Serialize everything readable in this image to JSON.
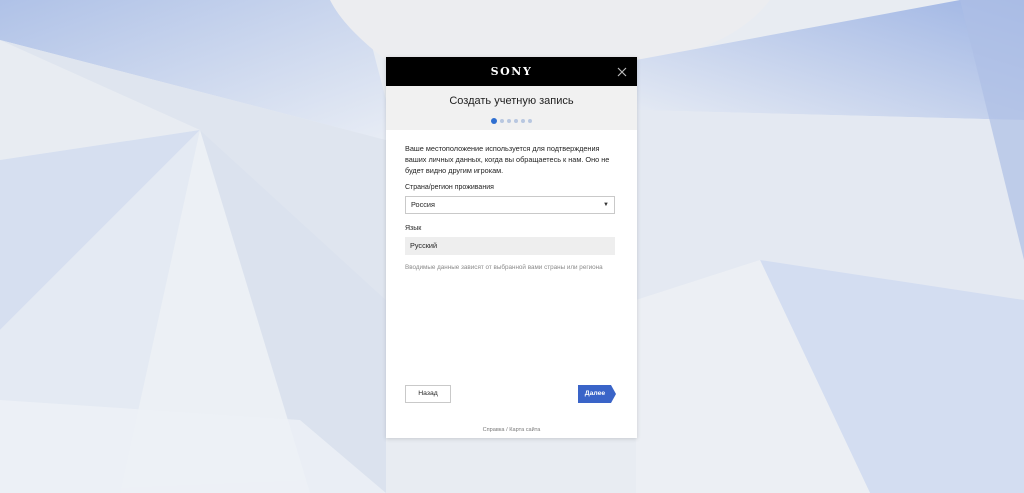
{
  "brand": {
    "logo_text": "SONY"
  },
  "dialog": {
    "title": "Создать учетную запись",
    "steps_total": 6,
    "current_step": 1,
    "description": "Ваше местоположение используется для подтверждения ваших личных данных, когда вы обращаетесь к нам. Оно не будет видно другим игрокам.",
    "country": {
      "label": "Страна/регион проживания",
      "value": "Россия"
    },
    "language": {
      "label": "Язык",
      "value": "Русский"
    },
    "hint": "Вводимые данные зависят от выбранной вами страны или региона",
    "buttons": {
      "back": "Назад",
      "next": "Далее"
    },
    "footer": {
      "help": "Справка",
      "separator": "/",
      "sitemap": "Карта сайта"
    }
  },
  "colors": {
    "accent": "#2f6fd1",
    "next_button": "#3a64c8",
    "topbar": "#000000"
  }
}
